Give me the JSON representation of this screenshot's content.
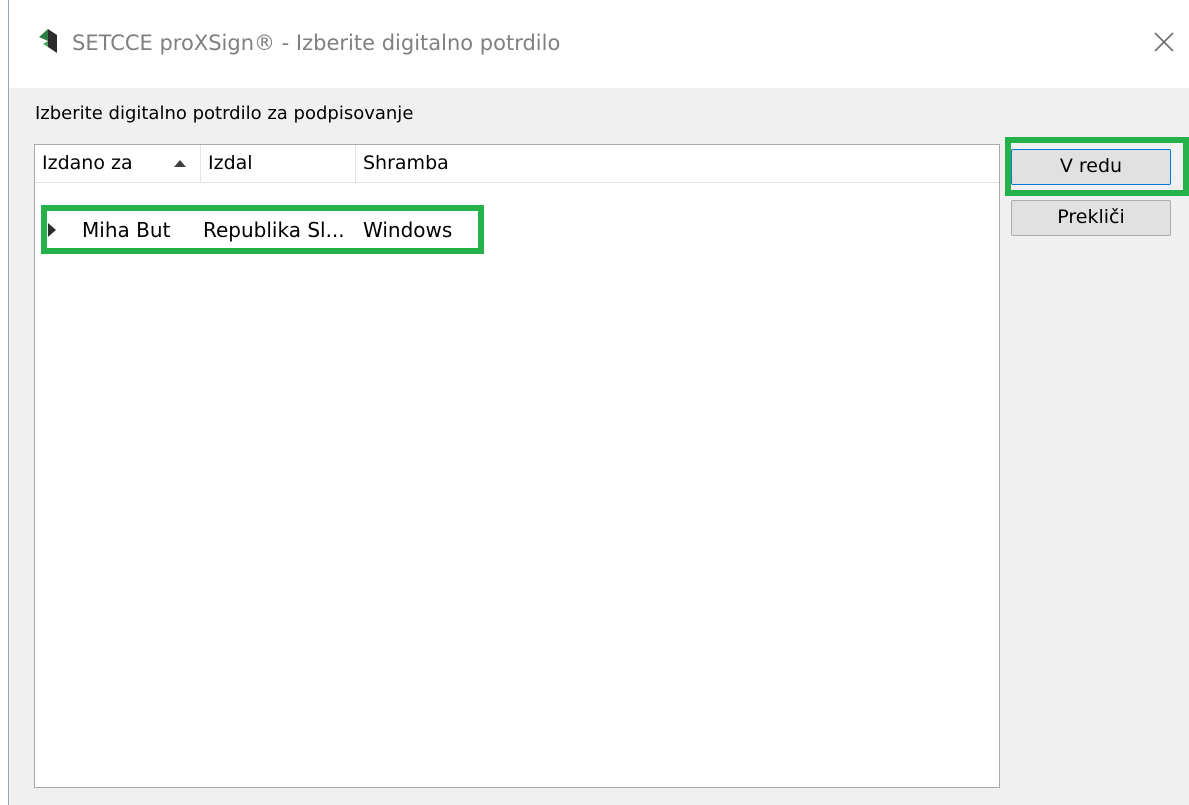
{
  "window": {
    "title": "SETCCE proXSign® - Izberite digitalno potrdilo",
    "app_icon": "setcce-logo-icon",
    "close_icon": "close-icon"
  },
  "prompt": "Izberite digitalno potrdilo za podpisovanje",
  "cert_list": {
    "columns": [
      "Izdano za",
      "Izdal",
      "Shramba"
    ],
    "sort_column": "Izdano za",
    "sort_direction": "ascending",
    "rows": [
      {
        "issued_to": "Miha But",
        "issuer": "Republika Sl...",
        "store": "Windows"
      }
    ]
  },
  "buttons": {
    "ok": "V redu",
    "cancel": "Prekliči"
  },
  "colors": {
    "highlight": "#26b24a",
    "window_bg": "#f0f0f0",
    "button_bg": "#e1e1e1"
  }
}
